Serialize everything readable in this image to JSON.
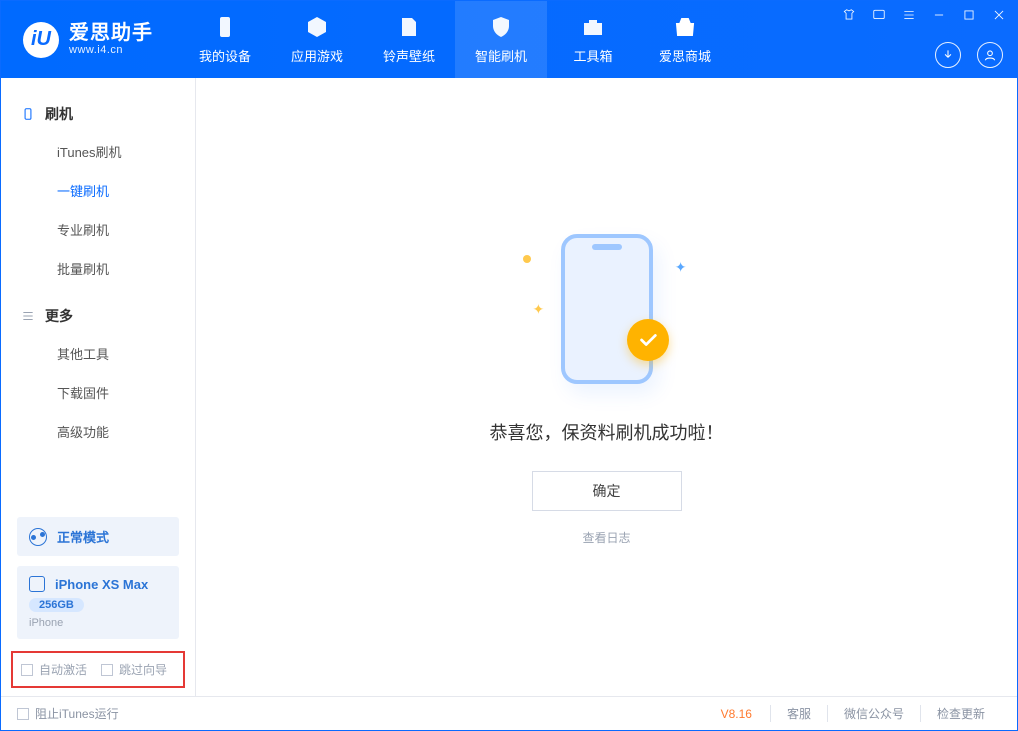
{
  "app": {
    "name_cn": "爱思助手",
    "name_en": "www.i4.cn",
    "logo_letter": "iU"
  },
  "topnav": {
    "items": [
      {
        "label": "我的设备"
      },
      {
        "label": "应用游戏"
      },
      {
        "label": "铃声壁纸"
      },
      {
        "label": "智能刷机"
      },
      {
        "label": "工具箱"
      },
      {
        "label": "爱思商城"
      }
    ],
    "active_index": 3
  },
  "sidebar": {
    "sections": [
      {
        "title": "刷机",
        "items": [
          {
            "label": "iTunes刷机"
          },
          {
            "label": "一键刷机"
          },
          {
            "label": "专业刷机"
          },
          {
            "label": "批量刷机"
          }
        ],
        "active_index": 1
      },
      {
        "title": "更多",
        "items": [
          {
            "label": "其他工具"
          },
          {
            "label": "下载固件"
          },
          {
            "label": "高级功能"
          }
        ],
        "active_index": -1
      }
    ],
    "mode_label": "正常模式",
    "device": {
      "name": "iPhone XS Max",
      "capacity": "256GB",
      "type": "iPhone"
    },
    "options": {
      "auto_activate": "自动激活",
      "skip_guide": "跳过向导"
    }
  },
  "main": {
    "success_text": "恭喜您，保资料刷机成功啦！",
    "ok_button": "确定",
    "log_link": "查看日志"
  },
  "statusbar": {
    "block_itunes": "阻止iTunes运行",
    "version": "V8.16",
    "links": {
      "support": "客服",
      "wechat": "微信公众号",
      "update": "检查更新"
    }
  }
}
